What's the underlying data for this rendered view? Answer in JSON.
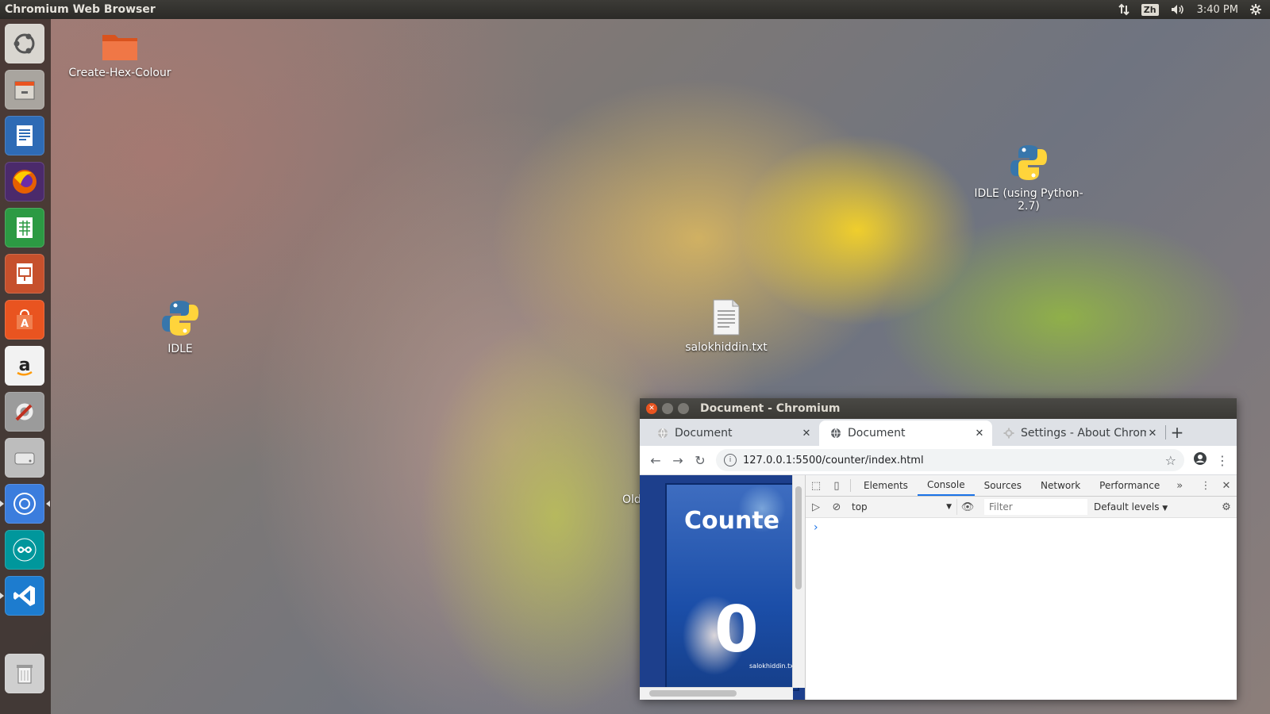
{
  "top_panel": {
    "title": "Chromium Web Browser",
    "lang": "Zh",
    "time": "3:40 PM"
  },
  "launcher": {
    "items": [
      {
        "name": "ubuntu-dash-icon",
        "color": "#d9d6d0"
      },
      {
        "name": "files-icon",
        "color": "#a9a59f"
      },
      {
        "name": "libreoffice-writer-icon",
        "color": "#2e6bb5"
      },
      {
        "name": "firefox-icon",
        "color": "#e66000"
      },
      {
        "name": "libreoffice-calc-icon",
        "color": "#2c9a43"
      },
      {
        "name": "libreoffice-impress-icon",
        "color": "#c6502c"
      },
      {
        "name": "software-center-icon",
        "color": "#e95420"
      },
      {
        "name": "amazon-icon",
        "color": "#f2f2f2"
      },
      {
        "name": "system-settings-icon",
        "color": "#9b9b9b"
      },
      {
        "name": "disk-icon",
        "color": "#bdbdbd"
      },
      {
        "name": "chromium-icon",
        "color": "#3b7ddd"
      },
      {
        "name": "arduino-icon",
        "color": "#00979c"
      },
      {
        "name": "vscode-icon",
        "color": "#1d7ccf"
      },
      {
        "name": "trash-icon",
        "color": "#cfcfcf"
      }
    ]
  },
  "desktop": {
    "icons": [
      {
        "name": "desktop-icon-folder",
        "label": "Create-Hex-Colour",
        "kind": "folder-icon"
      },
      {
        "name": "desktop-icon-idle27",
        "label": "IDLE (using Python-2.7)",
        "kind": "python-icon"
      },
      {
        "name": "desktop-icon-idle",
        "label": "IDLE",
        "kind": "python-icon"
      },
      {
        "name": "desktop-icon-txt",
        "label": "salokhiddin.txt",
        "kind": "text-file-icon"
      }
    ]
  },
  "browser": {
    "window_title": "Document - Chromium",
    "tabs": [
      {
        "label": "Document",
        "active": false
      },
      {
        "label": "Document",
        "active": true
      },
      {
        "label": "Settings - About Chrom",
        "active": false
      }
    ],
    "url": "127.0.0.1:5500/counter/index.html",
    "page": {
      "title": "Counte",
      "number": "0",
      "watermark": "salokhiddin.tx"
    },
    "peek_text": "Old",
    "devtools": {
      "tabs": [
        "Elements",
        "Console",
        "Sources",
        "Network",
        "Performance"
      ],
      "active_tab": "Console",
      "more": "»",
      "context": "top",
      "filter_placeholder": "Filter",
      "levels": "Default levels",
      "prompt": "›"
    }
  }
}
